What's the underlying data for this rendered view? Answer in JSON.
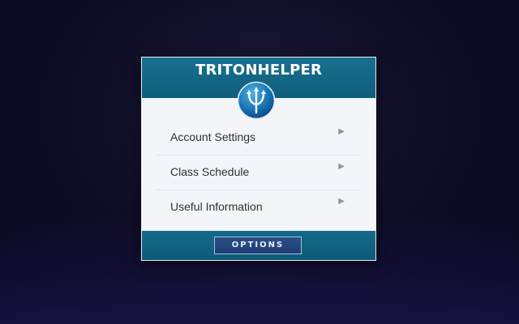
{
  "app": {
    "title": "TRITONHELPER",
    "logo_icon": "trident-icon",
    "accent_color": "#106281"
  },
  "menu": {
    "items": [
      {
        "label": "Account Settings",
        "icon": "chevron-right-icon"
      },
      {
        "label": "Class Schedule",
        "icon": "chevron-right-icon"
      },
      {
        "label": "Useful Information",
        "icon": "chevron-right-icon"
      }
    ]
  },
  "footer": {
    "options_label": "OPTIONS"
  }
}
